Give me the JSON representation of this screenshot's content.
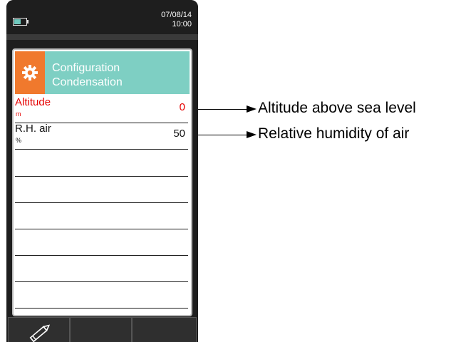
{
  "status": {
    "date": "07/08/14",
    "time": "10:00"
  },
  "header": {
    "line1": "Configuration",
    "line2": "Condensation",
    "icon": "gear-icon"
  },
  "rows": [
    {
      "label": "Altitude",
      "unit": "m",
      "value": "0",
      "selected": true
    },
    {
      "label": "R.H. air",
      "unit": "%",
      "value": "50",
      "selected": false
    }
  ],
  "softkeys": [
    {
      "icon": "pencil-icon"
    },
    {
      "icon": ""
    },
    {
      "icon": ""
    }
  ],
  "callouts": [
    {
      "text": "Altitude above sea level"
    },
    {
      "text": "Relative humidity of air"
    }
  ],
  "colors": {
    "header_bg": "#7ecfc3",
    "icon_bg": "#f0792d",
    "selected_text": "#e60000",
    "device_bg": "#1e1e1e"
  }
}
